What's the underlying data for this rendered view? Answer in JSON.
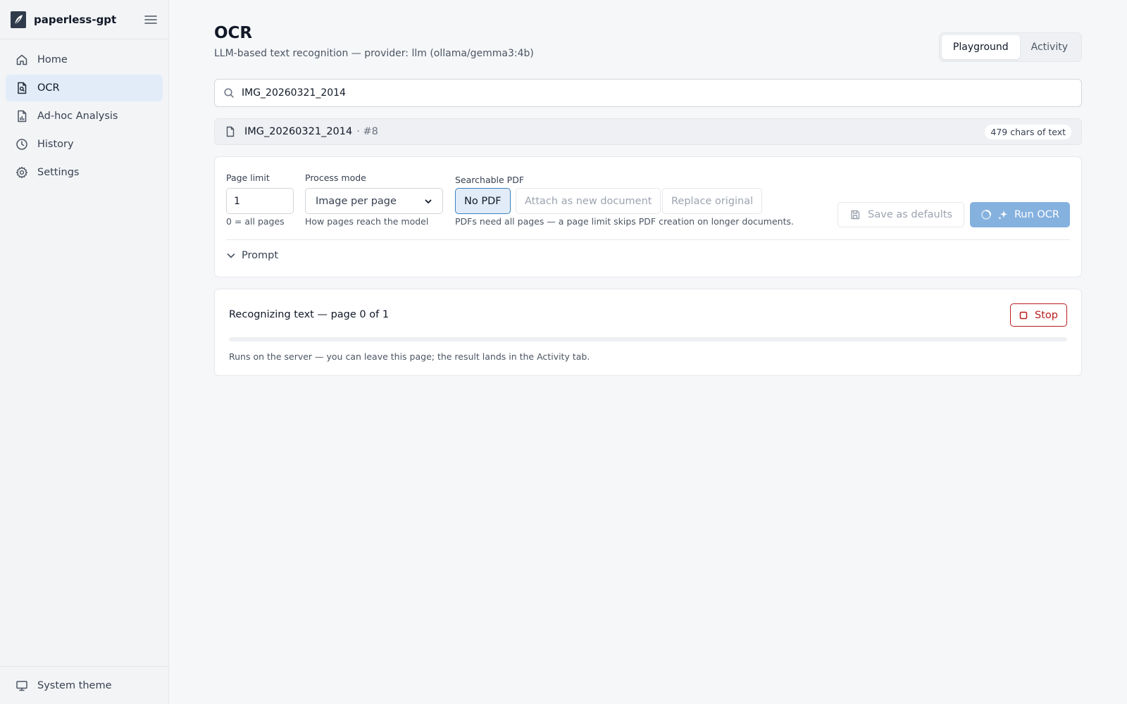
{
  "app": {
    "name": "paperless-gpt"
  },
  "sidebar": {
    "items": [
      {
        "label": "Home",
        "icon": "home-icon"
      },
      {
        "label": "OCR",
        "icon": "file-search-icon"
      },
      {
        "label": "Ad-hoc Analysis",
        "icon": "file-chart-icon"
      },
      {
        "label": "History",
        "icon": "clock-icon"
      },
      {
        "label": "Settings",
        "icon": "gear-icon"
      }
    ],
    "active": "OCR",
    "footer": {
      "label": "System theme",
      "icon": "monitor-icon"
    }
  },
  "header": {
    "title": "OCR",
    "subtitle": "LLM-based text recognition — provider: llm (ollama/gemma3:4b)",
    "tabs": [
      {
        "label": "Playground"
      },
      {
        "label": "Activity"
      }
    ],
    "active_tab": "Playground"
  },
  "search": {
    "value": "IMG_20260321_2014"
  },
  "document": {
    "name": "IMG_20260321_2014",
    "id": "· #8",
    "chars_badge": "479 chars of text"
  },
  "settings": {
    "page_limit": {
      "label": "Page limit",
      "value": "1",
      "help": "0 = all pages"
    },
    "process_mode": {
      "label": "Process mode",
      "value": "Image per page",
      "help": "How pages reach the model"
    },
    "searchable_pdf": {
      "label": "Searchable PDF",
      "options": [
        "No PDF",
        "Attach as new document",
        "Replace original"
      ],
      "selected": "No PDF",
      "help": "PDFs need all pages — a page limit skips PDF creation on longer documents."
    },
    "save_label": "Save as defaults",
    "run_label": "Run OCR",
    "prompt_label": "Prompt"
  },
  "progress": {
    "status": "Recognizing text — page 0 of 1",
    "stop_label": "Stop",
    "fraction": 0,
    "note": "Runs on the server — you can leave this page; the result lands in the Activity tab."
  },
  "colors": {
    "accent": "#85b1df",
    "active_bg": "#e2ecf8",
    "danger": "#b91c1c"
  }
}
